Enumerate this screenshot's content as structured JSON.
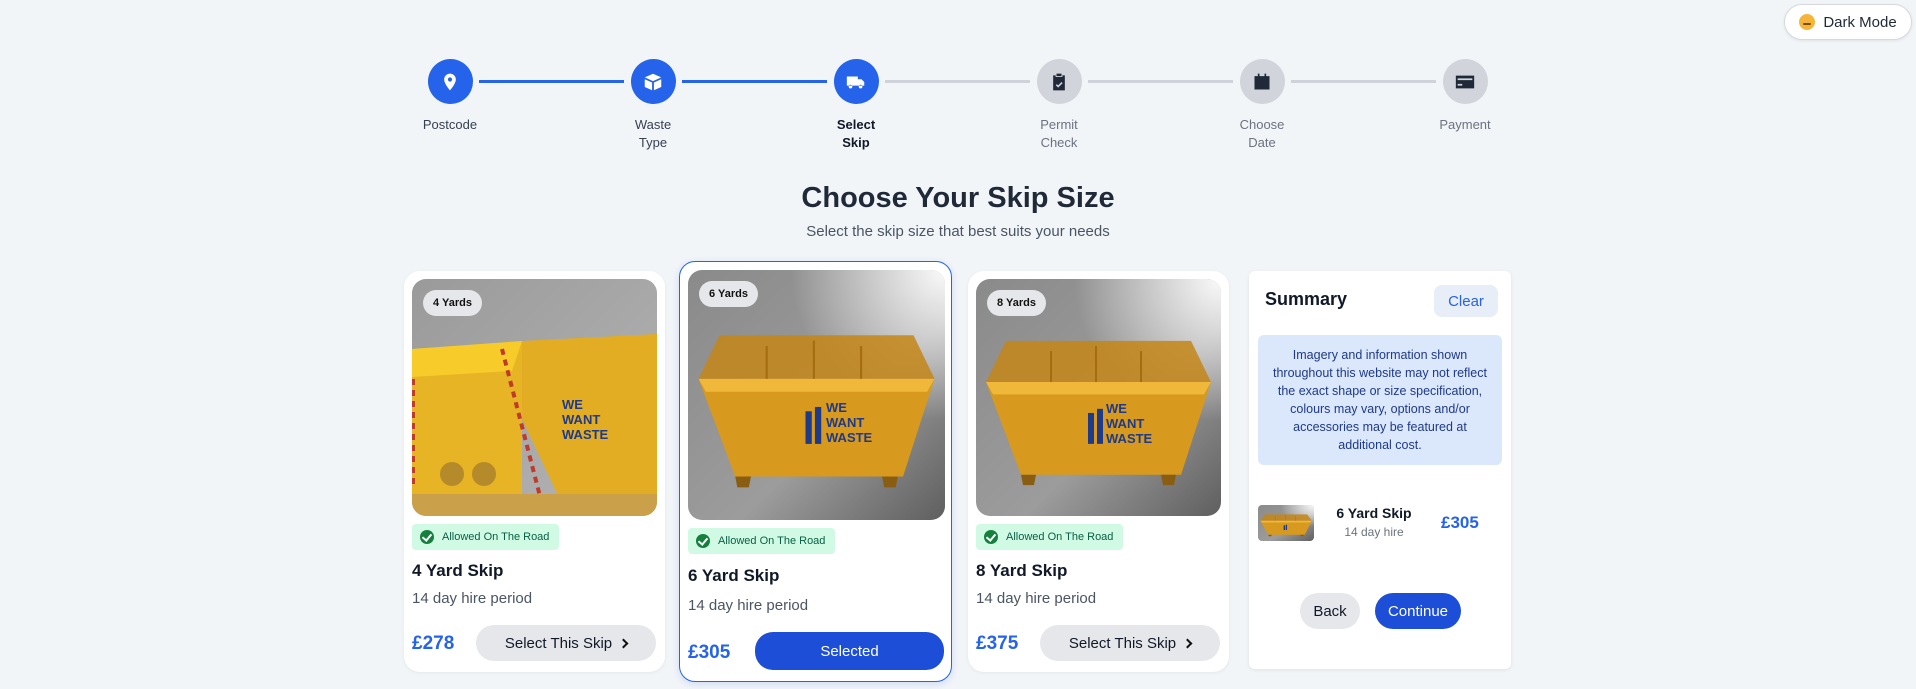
{
  "theme_toggle": {
    "label": "Dark Mode"
  },
  "steps": [
    {
      "line1": "Postcode",
      "line2": "",
      "icon": "map-pin-icon"
    },
    {
      "line1": "Waste",
      "line2": "Type",
      "icon": "box-icon"
    },
    {
      "line1": "Select",
      "line2": "Skip",
      "icon": "truck-icon"
    },
    {
      "line1": "Permit",
      "line2": "Check",
      "icon": "clipboard-check-icon"
    },
    {
      "line1": "Choose",
      "line2": "Date",
      "icon": "calendar-icon"
    },
    {
      "line1": "Payment",
      "line2": "",
      "icon": "credit-card-icon"
    }
  ],
  "page": {
    "title": "Choose Your Skip Size",
    "subtitle": "Select the skip size that best suits your needs"
  },
  "skips": [
    {
      "yards": "4 Yards",
      "badge": "Allowed On The Road",
      "name": "4 Yard Skip",
      "period": "14 day hire period",
      "price": "£278",
      "button": "Select This Skip"
    },
    {
      "yards": "6 Yards",
      "badge": "Allowed On The Road",
      "name": "6 Yard Skip",
      "period": "14 day hire period",
      "price": "£305",
      "button": "Selected"
    },
    {
      "yards": "8 Yards",
      "badge": "Allowed On The Road",
      "name": "8 Yard Skip",
      "period": "14 day hire period",
      "price": "£375",
      "button": "Select This Skip"
    }
  ],
  "skip_brand": {
    "line1": "WE",
    "line2": "WANT",
    "line3": "WASTE"
  },
  "summary": {
    "title": "Summary",
    "clear": "Clear",
    "notice": "Imagery and information shown throughout this website may not reflect the exact shape or size specification, colours may vary, options and/or accessories may be featured at additional cost.",
    "item_name": "6 Yard Skip",
    "item_hire": "14 day hire",
    "item_price": "£305",
    "back": "Back",
    "continue": "Continue"
  },
  "colors": {
    "accent": "#2563eb",
    "skip_yellow": "#e0a926",
    "badge_green": "#d1fae5"
  }
}
